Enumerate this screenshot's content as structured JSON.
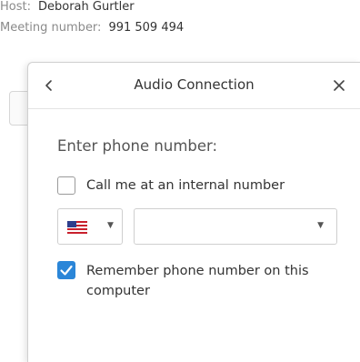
{
  "meeting_info": {
    "host_label": "Host:",
    "host_name": "Deborah Gurtler",
    "meeting_number_label": "Meeting number:",
    "meeting_number": "991 509 494"
  },
  "dialog": {
    "title": "Audio Connection",
    "back_icon": "chevron-left-icon",
    "close_icon": "close-icon",
    "prompt": "Enter phone number:",
    "call_internal": {
      "label": "Call me at an internal number",
      "checked": false
    },
    "country_select": {
      "flag": "us-flag-icon",
      "selected": ""
    },
    "phone_select": {
      "value": ""
    },
    "remember": {
      "label": "Remember phone number on this computer",
      "checked": true
    }
  },
  "colors": {
    "accent": "#2b86d8",
    "muted_text": "#8a8a8a",
    "text": "#333333"
  }
}
